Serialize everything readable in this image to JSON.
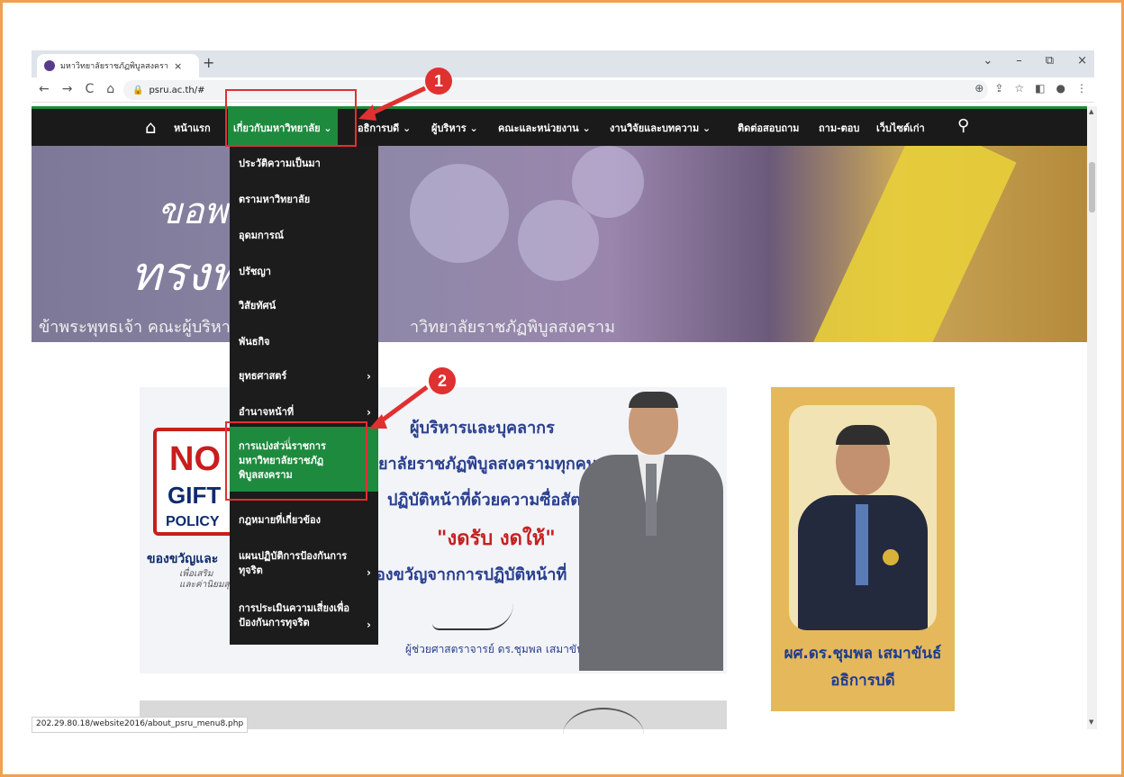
{
  "browser": {
    "tab_title": "มหาวิทยาลัยราชภัฏพิบูลสงคราม – Pib",
    "tab_close": "×",
    "new_tab": "+",
    "url": "psru.ac.th/#",
    "win_controls": [
      "⌄",
      "–",
      "⧉",
      "×"
    ]
  },
  "nav": {
    "items": [
      "หน้าแรก",
      "เกี่ยวกับมหาวิทยาลัย ⌄",
      "อธิการบดี ⌄",
      "ผู้บริหาร ⌄",
      "คณะและหน่วยงาน ⌄",
      "งานวิจัยและบทความ ⌄",
      "ติดต่อสอบถาม",
      "ถาม-ตอบ",
      "เว็บไซต์เก่า"
    ]
  },
  "hero": {
    "line1": "ขอพ",
    "line2": "ทรงพ        ญ",
    "line3a": "ข้าพระพุทธเจ้า คณะผู้บริหาร",
    "line3b": "าวิทยาลัยราชภัฏพิบูลสงคราม"
  },
  "dropdown": {
    "items": [
      {
        "label": "ประวัติความเป็นมา",
        "arrow": ""
      },
      {
        "label": "ตรามหาวิทยาลัย",
        "arrow": ""
      },
      {
        "label": "อุดมการณ์",
        "arrow": ""
      },
      {
        "label": "ปรัชญา",
        "arrow": ""
      },
      {
        "label": "วิสัยทัศน์",
        "arrow": ""
      },
      {
        "label": "พันธกิจ",
        "arrow": ""
      },
      {
        "label": "ยุทธศาสตร์",
        "arrow": "›"
      },
      {
        "label": "อำนาจหน้าที่",
        "arrow": "›"
      },
      {
        "label": "การแบ่งส่วนราชการ มหาวิทยาลัยราชภัฏพิบูลสงคราม",
        "arrow": ""
      },
      {
        "label": "กฎหมายที่เกี่ยวข้อง",
        "arrow": ""
      },
      {
        "label": "แผนปฏิบัติการป้องกันการทุจริต",
        "arrow": "›"
      },
      {
        "label": "การประเมินความเสี่ยงเพื่อป้องกันการทุจริต",
        "arrow": "›"
      }
    ]
  },
  "banner": {
    "nogift_no": "NO",
    "nogift_gift": "GIFT",
    "nogift_policy": "POLICY",
    "gift_caption": "ของขวัญและ",
    "gift_sub1": "เพื่อเสริม",
    "gift_sub2": "และค่านิยมสุจ",
    "title": "ผู้บริหารและบุคลากร",
    "line2": "ยาลัยราชภัฏพิบูลสงครามทุกคน",
    "line3": "ปฏิบัติหน้าที่ด้วยความซื่อสัตย์",
    "line4": "\"งดรับ งดให้\"",
    "line5": "องขวัญจากการปฏิบัติหน้าที่",
    "signer": "ผู้ช่วยศาสตราจารย์ ดร.ชุมพล เสมาขันธ์"
  },
  "portrait": {
    "name": "ผศ.ดร.ชุมพล เสมาขันธ์",
    "role": "อธิการบดี"
  },
  "status_url": "202.29.80.18/website2016/about_psru_menu8.php",
  "markers": [
    "1",
    "2"
  ],
  "colors": {
    "accent": "#1e8a3e",
    "nav_bg": "#1a1a1a",
    "annotation": "#e03030",
    "frame": "#f0a050"
  }
}
